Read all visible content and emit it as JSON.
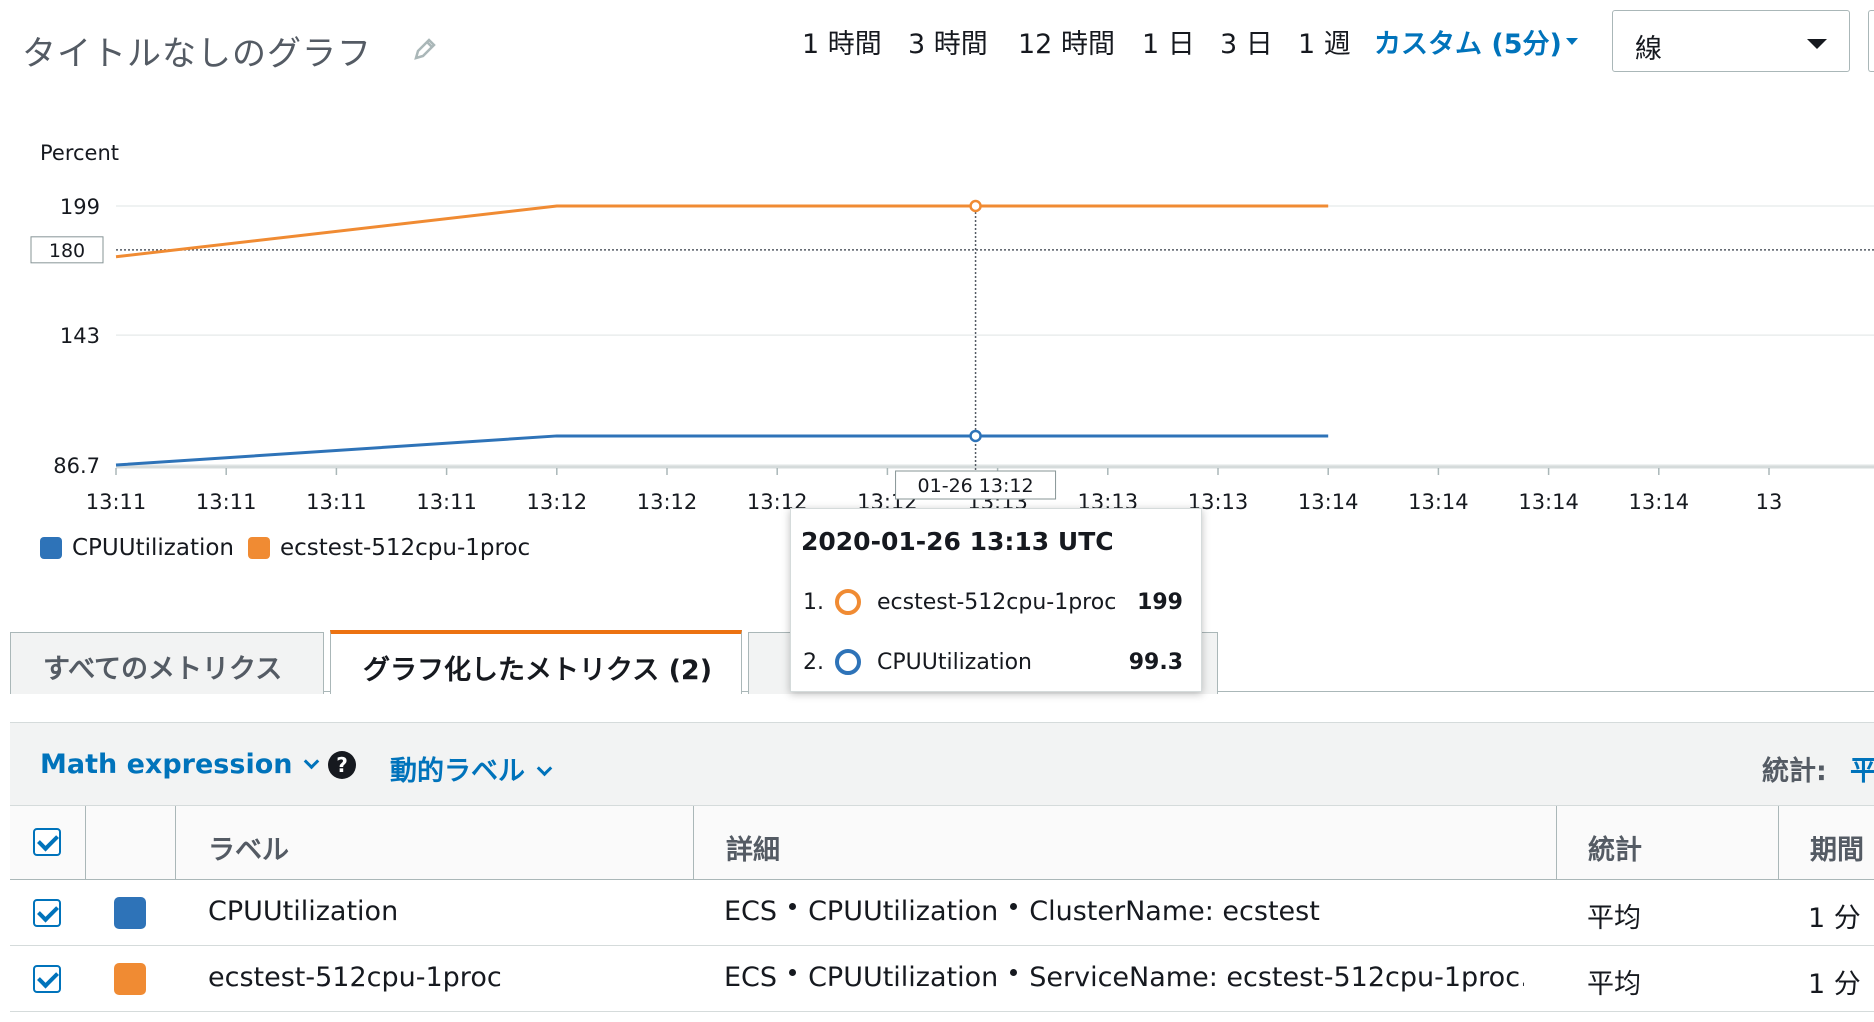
{
  "header": {
    "title": "タイトルなしのグラフ",
    "time_ranges": [
      "1 時間",
      "3 時間",
      "12 時間",
      "1 日",
      "3 日",
      "1 週"
    ],
    "custom_range": "カスタム (5分)",
    "chart_type_select": "線"
  },
  "chart_data": {
    "type": "line",
    "ylabel": "Percent",
    "y_ticks": [
      "199",
      "143",
      "86.7"
    ],
    "threshold_label": "180",
    "x_ticks": [
      "13:11",
      "13:11",
      "13:11",
      "13:11",
      "13:12",
      "13:12",
      "13:12",
      "13:12",
      "13:13",
      "13:13",
      "13:13",
      "13:14",
      "13:14",
      "13:14",
      "13:14",
      "13"
    ],
    "cursor_label": "01-26 13:12",
    "series": [
      {
        "name": "CPUUtilization",
        "color": "#2e73b8",
        "points": [
          [
            0,
            86.7
          ],
          [
            4,
            99.3
          ],
          [
            11,
            99.3
          ]
        ]
      },
      {
        "name": "ecstest-512cpu-1proc",
        "color": "#f08b33",
        "points": [
          [
            0,
            177
          ],
          [
            4,
            199
          ],
          [
            11,
            199
          ]
        ]
      }
    ],
    "hover_index": 7.8
  },
  "legend": [
    "CPUUtilization",
    "ecstest-512cpu-1proc"
  ],
  "tooltip": {
    "title": "2020-01-26 13:13 UTC",
    "rows": [
      {
        "num": "1.",
        "name": "ecstest-512cpu-1proc",
        "value": "199",
        "color": "#f08b33"
      },
      {
        "num": "2.",
        "name": "CPUUtilization",
        "value": "99.3",
        "color": "#2e73b8"
      }
    ]
  },
  "tabs": {
    "all_metrics": "すべてのメトリクス",
    "graphed_metrics": "グラフ化したメトリクス (2)"
  },
  "toolbar": {
    "math_expression": "Math expression",
    "dynamic_label": "動的ラベル",
    "stat_label": "統計:",
    "stat_value": "平"
  },
  "table": {
    "headers": {
      "label": "ラベル",
      "details": "詳細",
      "statistic": "統計",
      "period": "期間"
    },
    "rows": [
      {
        "color": "#2e73b8",
        "label": "CPUUtilization",
        "details": [
          "ECS",
          "CPUUtilization",
          "ClusterName: ecstest"
        ],
        "statistic": "平均",
        "period": "1 分"
      },
      {
        "color": "#f08b33",
        "label": "ecstest-512cpu-1proc",
        "details": [
          "ECS",
          "CPUUtilization",
          "ServiceName: ecstest-512cpu-1proc…"
        ],
        "statistic": "平均",
        "period": "1 分"
      }
    ]
  }
}
